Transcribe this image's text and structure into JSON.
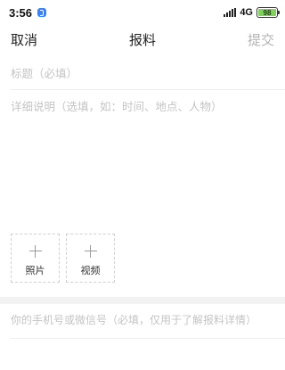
{
  "status_bar": {
    "time": "3:56",
    "app_icon": "app-notification-icon",
    "signal_icon": "signal-bars-icon",
    "network": "4G",
    "battery_level": "98",
    "battery_color": "#7fd35a"
  },
  "nav": {
    "cancel_label": "取消",
    "title": "报料",
    "submit_label": "提交",
    "submit_color": "#b3b3b3"
  },
  "form": {
    "title_placeholder": "标题（必填）",
    "title_value": "",
    "description_placeholder": "详细说明（选填，如：时间、地点、人物）",
    "description_value": "",
    "photo_label": "照片",
    "video_label": "视频",
    "upload_icon": "plus-icon",
    "contact_placeholder": "你的手机号或微信号（必填，仅用于了解报料详情）",
    "contact_value": ""
  }
}
